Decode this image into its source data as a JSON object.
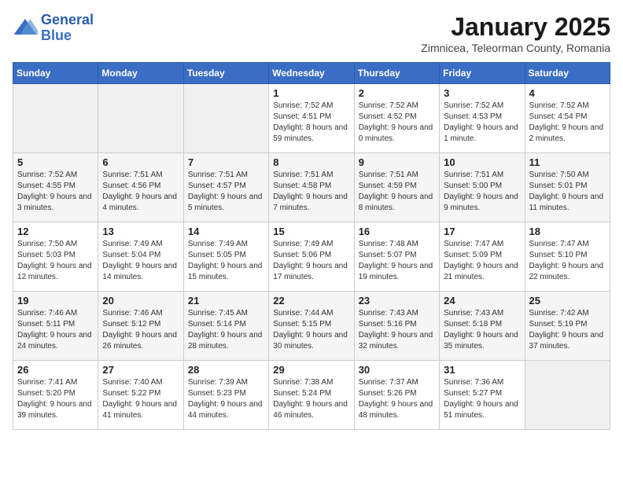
{
  "header": {
    "logo_line1": "General",
    "logo_line2": "Blue",
    "month": "January 2025",
    "location": "Zimnicea, Teleorman County, Romania"
  },
  "days_of_week": [
    "Sunday",
    "Monday",
    "Tuesday",
    "Wednesday",
    "Thursday",
    "Friday",
    "Saturday"
  ],
  "weeks": [
    [
      {
        "day": "",
        "info": ""
      },
      {
        "day": "",
        "info": ""
      },
      {
        "day": "",
        "info": ""
      },
      {
        "day": "1",
        "info": "Sunrise: 7:52 AM\nSunset: 4:51 PM\nDaylight: 8 hours and 59 minutes."
      },
      {
        "day": "2",
        "info": "Sunrise: 7:52 AM\nSunset: 4:52 PM\nDaylight: 9 hours and 0 minutes."
      },
      {
        "day": "3",
        "info": "Sunrise: 7:52 AM\nSunset: 4:53 PM\nDaylight: 9 hours and 1 minute."
      },
      {
        "day": "4",
        "info": "Sunrise: 7:52 AM\nSunset: 4:54 PM\nDaylight: 9 hours and 2 minutes."
      }
    ],
    [
      {
        "day": "5",
        "info": "Sunrise: 7:52 AM\nSunset: 4:55 PM\nDaylight: 9 hours and 3 minutes."
      },
      {
        "day": "6",
        "info": "Sunrise: 7:51 AM\nSunset: 4:56 PM\nDaylight: 9 hours and 4 minutes."
      },
      {
        "day": "7",
        "info": "Sunrise: 7:51 AM\nSunset: 4:57 PM\nDaylight: 9 hours and 5 minutes."
      },
      {
        "day": "8",
        "info": "Sunrise: 7:51 AM\nSunset: 4:58 PM\nDaylight: 9 hours and 7 minutes."
      },
      {
        "day": "9",
        "info": "Sunrise: 7:51 AM\nSunset: 4:59 PM\nDaylight: 9 hours and 8 minutes."
      },
      {
        "day": "10",
        "info": "Sunrise: 7:51 AM\nSunset: 5:00 PM\nDaylight: 9 hours and 9 minutes."
      },
      {
        "day": "11",
        "info": "Sunrise: 7:50 AM\nSunset: 5:01 PM\nDaylight: 9 hours and 11 minutes."
      }
    ],
    [
      {
        "day": "12",
        "info": "Sunrise: 7:50 AM\nSunset: 5:03 PM\nDaylight: 9 hours and 12 minutes."
      },
      {
        "day": "13",
        "info": "Sunrise: 7:49 AM\nSunset: 5:04 PM\nDaylight: 9 hours and 14 minutes."
      },
      {
        "day": "14",
        "info": "Sunrise: 7:49 AM\nSunset: 5:05 PM\nDaylight: 9 hours and 15 minutes."
      },
      {
        "day": "15",
        "info": "Sunrise: 7:49 AM\nSunset: 5:06 PM\nDaylight: 9 hours and 17 minutes."
      },
      {
        "day": "16",
        "info": "Sunrise: 7:48 AM\nSunset: 5:07 PM\nDaylight: 9 hours and 19 minutes."
      },
      {
        "day": "17",
        "info": "Sunrise: 7:47 AM\nSunset: 5:09 PM\nDaylight: 9 hours and 21 minutes."
      },
      {
        "day": "18",
        "info": "Sunrise: 7:47 AM\nSunset: 5:10 PM\nDaylight: 9 hours and 22 minutes."
      }
    ],
    [
      {
        "day": "19",
        "info": "Sunrise: 7:46 AM\nSunset: 5:11 PM\nDaylight: 9 hours and 24 minutes."
      },
      {
        "day": "20",
        "info": "Sunrise: 7:46 AM\nSunset: 5:12 PM\nDaylight: 9 hours and 26 minutes."
      },
      {
        "day": "21",
        "info": "Sunrise: 7:45 AM\nSunset: 5:14 PM\nDaylight: 9 hours and 28 minutes."
      },
      {
        "day": "22",
        "info": "Sunrise: 7:44 AM\nSunset: 5:15 PM\nDaylight: 9 hours and 30 minutes."
      },
      {
        "day": "23",
        "info": "Sunrise: 7:43 AM\nSunset: 5:16 PM\nDaylight: 9 hours and 32 minutes."
      },
      {
        "day": "24",
        "info": "Sunrise: 7:43 AM\nSunset: 5:18 PM\nDaylight: 9 hours and 35 minutes."
      },
      {
        "day": "25",
        "info": "Sunrise: 7:42 AM\nSunset: 5:19 PM\nDaylight: 9 hours and 37 minutes."
      }
    ],
    [
      {
        "day": "26",
        "info": "Sunrise: 7:41 AM\nSunset: 5:20 PM\nDaylight: 9 hours and 39 minutes."
      },
      {
        "day": "27",
        "info": "Sunrise: 7:40 AM\nSunset: 5:22 PM\nDaylight: 9 hours and 41 minutes."
      },
      {
        "day": "28",
        "info": "Sunrise: 7:39 AM\nSunset: 5:23 PM\nDaylight: 9 hours and 44 minutes."
      },
      {
        "day": "29",
        "info": "Sunrise: 7:38 AM\nSunset: 5:24 PM\nDaylight: 9 hours and 46 minutes."
      },
      {
        "day": "30",
        "info": "Sunrise: 7:37 AM\nSunset: 5:26 PM\nDaylight: 9 hours and 48 minutes."
      },
      {
        "day": "31",
        "info": "Sunrise: 7:36 AM\nSunset: 5:27 PM\nDaylight: 9 hours and 51 minutes."
      },
      {
        "day": "",
        "info": ""
      }
    ]
  ]
}
